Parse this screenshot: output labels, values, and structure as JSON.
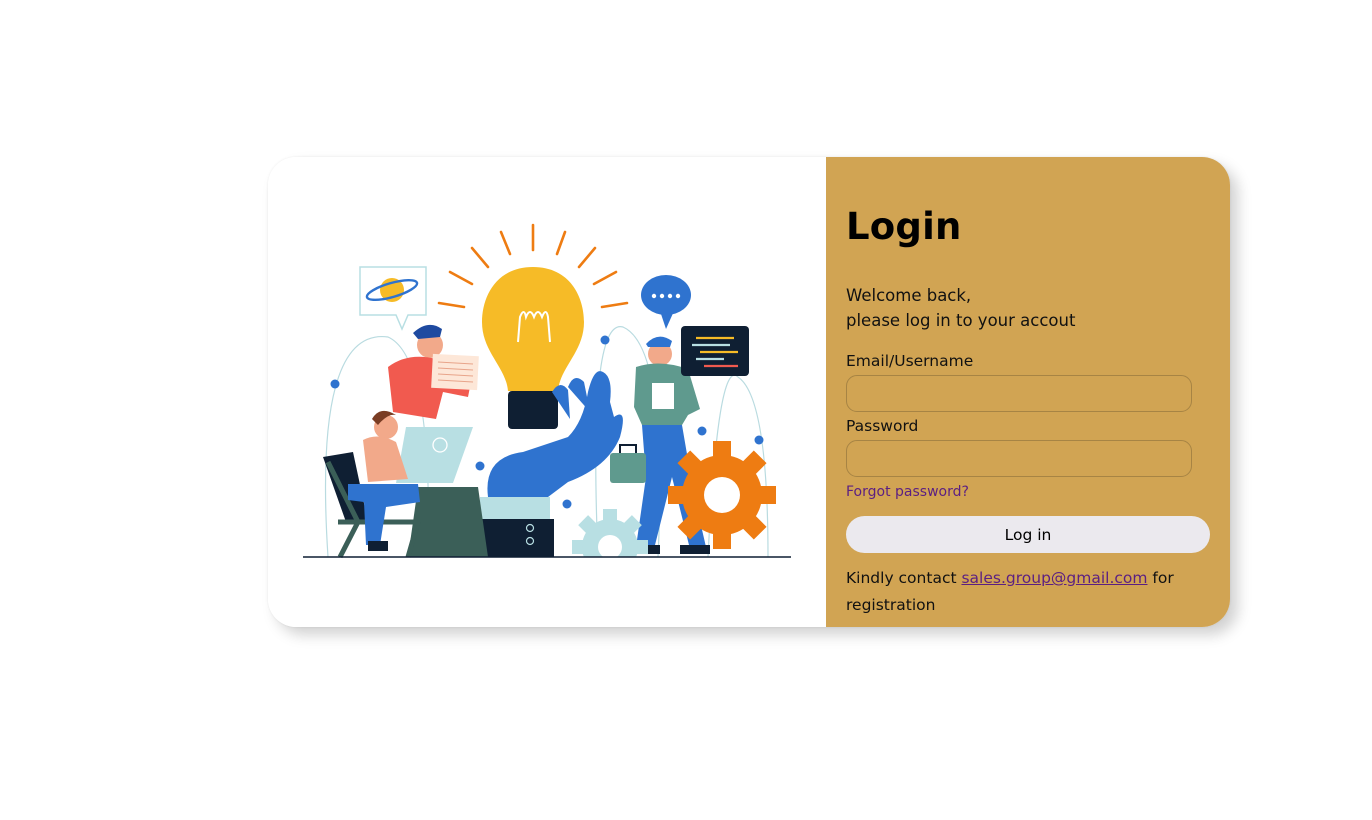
{
  "login": {
    "title": "Login",
    "welcome_line1": "Welcome back,",
    "welcome_line2": "please log in to your accout",
    "email_label": "Email/Username",
    "email_value": "",
    "password_label": "Password",
    "password_value": "",
    "forgot_link": "Forgot password?",
    "login_button": "Log in",
    "contact_prefix": "Kindly contact ",
    "contact_email": "sales.group@gmail.com",
    "contact_suffix": " for registration"
  },
  "colors": {
    "form_panel_bg": "#d1a453",
    "link_color": "#5b1f82",
    "button_bg": "#ebe9ee",
    "bulb_yellow": "#f6bb27",
    "accent_blue": "#2f73cf",
    "accent_orange": "#ee7c12"
  },
  "illustration": {
    "icon": "teamwork-idea-illustration"
  }
}
